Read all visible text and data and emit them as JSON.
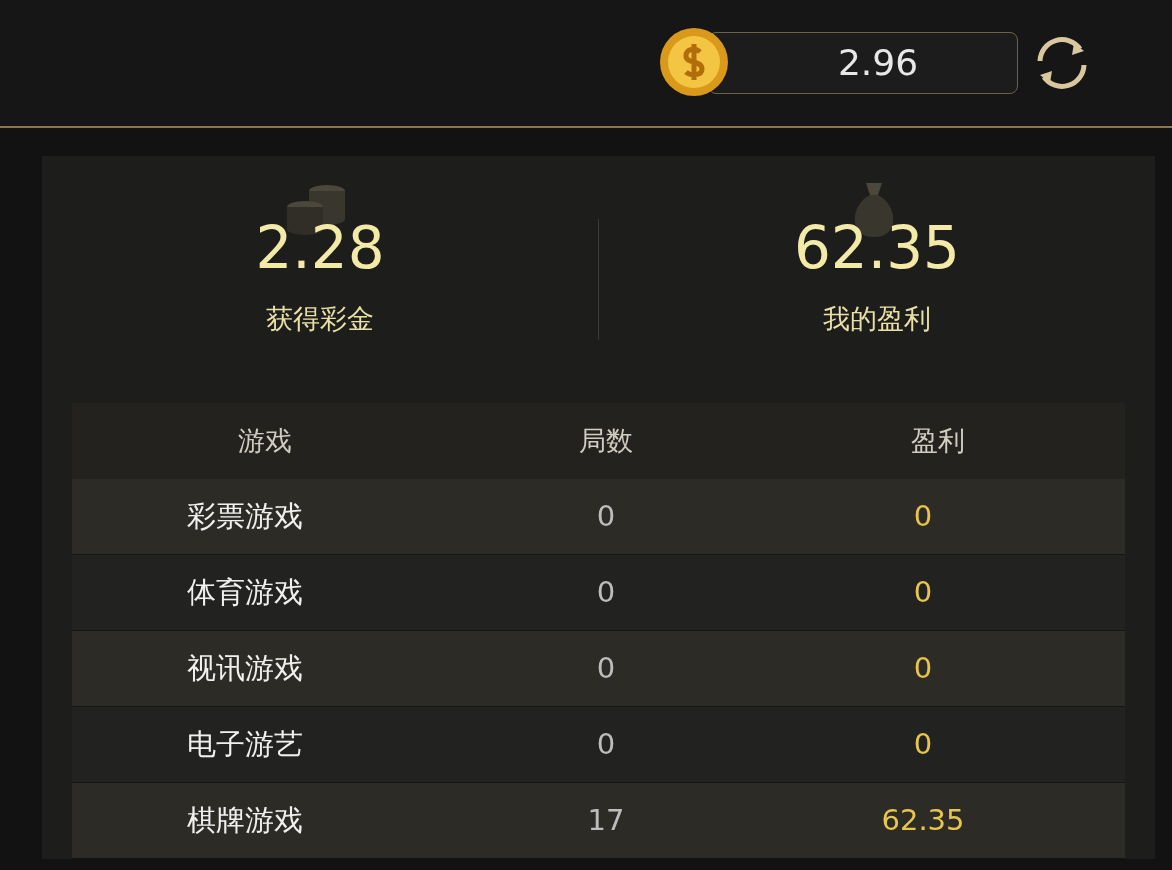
{
  "header": {
    "balance": "2.96"
  },
  "stats": [
    {
      "kind": "coins",
      "value": "2.28",
      "label": "获得彩金"
    },
    {
      "kind": "bag",
      "value": "62.35",
      "label": "我的盈利"
    }
  ],
  "table": {
    "columns": [
      "游戏",
      "局数",
      "盈利"
    ],
    "rows": [
      [
        "彩票游戏",
        "0",
        "0"
      ],
      [
        "体育游戏",
        "0",
        "0"
      ],
      [
        "视讯游戏",
        "0",
        "0"
      ],
      [
        "电子游艺",
        "0",
        "0"
      ],
      [
        "棋牌游戏",
        "17",
        "62.35"
      ]
    ]
  }
}
